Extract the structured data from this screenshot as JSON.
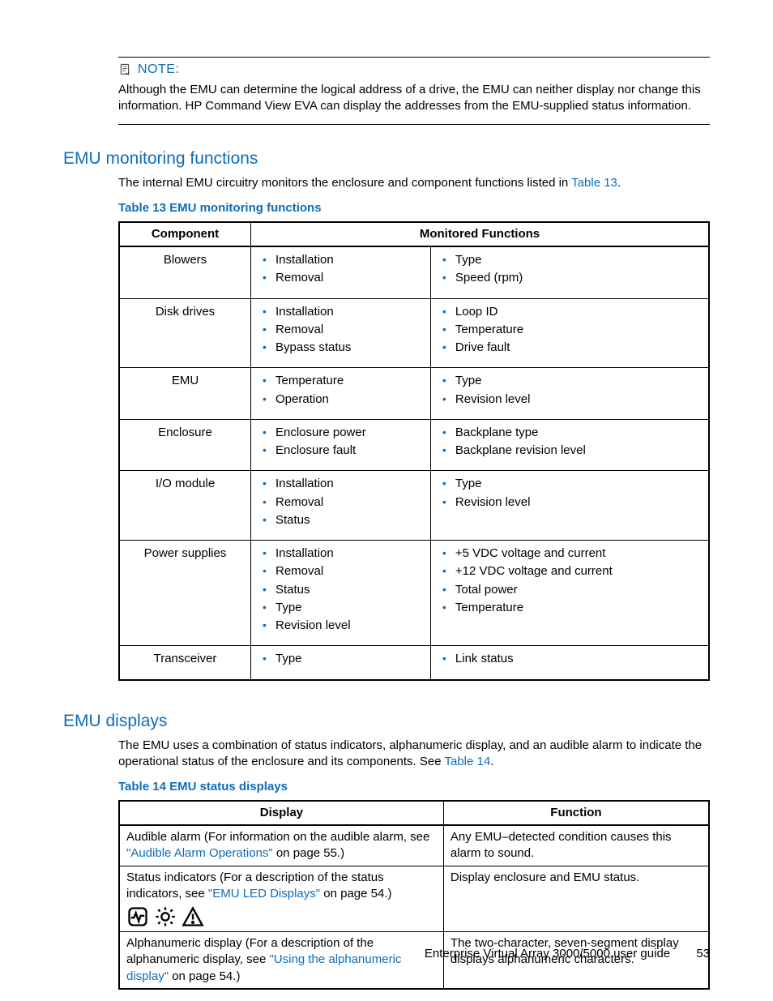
{
  "note": {
    "label": "NOTE:",
    "text": "Although the EMU can determine the logical address of a drive, the EMU can neither display nor change this information. HP Command View EVA can display the addresses from the EMU-supplied status information."
  },
  "section1": {
    "heading": "EMU monitoring functions",
    "intro_pre": "The internal EMU circuitry monitors the enclosure and component functions listed in ",
    "intro_link": "Table 13",
    "intro_post": ".",
    "table_caption": "Table 13 EMU monitoring functions",
    "head_component": "Component",
    "head_monitored": "Monitored Functions",
    "rows": [
      {
        "component": "Blowers",
        "left": [
          "Installation",
          "Removal"
        ],
        "right": [
          "Type",
          "Speed (rpm)"
        ]
      },
      {
        "component": "Disk drives",
        "left": [
          "Installation",
          "Removal",
          "Bypass status"
        ],
        "right": [
          "Loop ID",
          "Temperature",
          "Drive fault"
        ]
      },
      {
        "component": "EMU",
        "left": [
          "Temperature",
          "Operation"
        ],
        "right": [
          "Type",
          "Revision level"
        ]
      },
      {
        "component": "Enclosure",
        "left": [
          "Enclosure power",
          "Enclosure fault"
        ],
        "right": [
          "Backplane type",
          "Backplane revision level"
        ]
      },
      {
        "component": "I/O module",
        "left": [
          "Installation",
          "Removal",
          "Status"
        ],
        "right": [
          "Type",
          "Revision level"
        ]
      },
      {
        "component": "Power supplies",
        "left": [
          "Installation",
          "Removal",
          "Status",
          "Type",
          "Revision level"
        ],
        "right": [
          "+5 VDC voltage and current",
          "+12 VDC voltage and current",
          "Total power",
          "Temperature"
        ]
      },
      {
        "component": "Transceiver",
        "left": [
          "Type"
        ],
        "right": [
          "Link status"
        ]
      }
    ]
  },
  "section2": {
    "heading": "EMU displays",
    "intro_pre": "The EMU uses a combination of status indicators, alphanumeric display, and an audible alarm to indicate the operational status of the enclosure and its components. See ",
    "intro_link": "Table 14",
    "intro_post": ".",
    "table_caption": "Table 14 EMU status displays",
    "head_display": "Display",
    "head_function": "Function",
    "rows": [
      {
        "d_pre": "Audible alarm (For information on the audible alarm, see ",
        "d_link": "\"Audible Alarm Operations\"",
        "d_post": " on page 55.)",
        "function": "Any EMU–detected condition causes this alarm to sound.",
        "icons": false
      },
      {
        "d_pre": "Status indicators (For a description of the status indicators, see ",
        "d_link": "\"EMU LED Displays\"",
        "d_post": " on page 54.)",
        "function": "Display enclosure and EMU status.",
        "icons": true
      },
      {
        "d_pre": "Alphanumeric display (For a description of the alphanumeric display, see ",
        "d_link": "\"Using the alphanumeric display\"",
        "d_post": " on page 54.)",
        "function": "The two-character, seven-segment display displays alphanumeric characters.",
        "icons": false
      }
    ]
  },
  "footer": {
    "title": "Enterprise Virtual Array 3000/5000 user guide",
    "page": "53"
  }
}
